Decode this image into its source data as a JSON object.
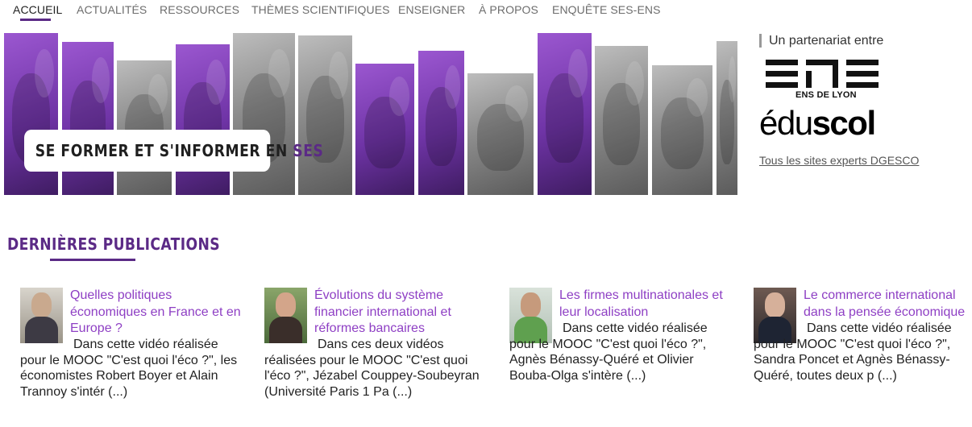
{
  "nav": {
    "items": [
      {
        "label": "ACCUEIL",
        "active": true
      },
      {
        "label": "ACTUALITÉS",
        "active": false
      },
      {
        "label": "RESSOURCES",
        "active": false
      },
      {
        "label": "THÈMES SCIENTIFIQUES",
        "active": false
      },
      {
        "label": "ENSEIGNER",
        "active": false
      },
      {
        "label": "À PROPOS",
        "active": false
      },
      {
        "label": "ENQUÊTE SES-ENS",
        "active": false
      }
    ]
  },
  "banner": {
    "label_main": "SE FORMER ET S'INFORMER EN ",
    "label_accent": "SES",
    "strips": [
      "purple",
      "purple",
      "gray",
      "purple",
      "gray",
      "gray",
      "purple",
      "purple",
      "gray",
      "purple",
      "gray",
      "gray",
      "gray"
    ]
  },
  "partner": {
    "title": "Un partenariat entre",
    "ens_logo_text": "ENS",
    "ens_subtitle": "ENS DE LYON",
    "eduscol_light": "édu",
    "eduscol_bold": "scol",
    "link": "Tous les sites experts DGESCO"
  },
  "section": {
    "title": "DERNIÈRES PUBLICATIONS"
  },
  "publications": [
    {
      "title": "Quelles politiques économiques en France et en Europe ?",
      "excerpt": "Dans cette vidéo réalisée pour le MOOC \"C'est quoi l'éco ?\", les économistes Robert Boyer et Alain Trannoy s'intér (...)",
      "thumb_icon": "portrait-photo"
    },
    {
      "title": "Évolutions du système financier international et réformes bancaires",
      "excerpt": "Dans ces deux vidéos réalisées pour le MOOC \"C'est quoi l'éco ?\", Jézabel Couppey-Soubeyran (Université Paris 1 Pa (...)",
      "thumb_icon": "portrait-photo"
    },
    {
      "title": "Les firmes multinationales et leur localisation",
      "excerpt": "Dans cette vidéo réalisée pour le MOOC \"C'est quoi l'éco ?\", Agnès Bénassy-Quéré et Olivier Bouba-Olga s'intère (...)",
      "thumb_icon": "portrait-photo"
    },
    {
      "title": "Le commerce international dans la pensée économique",
      "excerpt": "Dans cette vidéo réalisée pour le MOOC \"C'est quoi l'éco ?\", Sandra Poncet et Agnès Bénassy-Quéré, toutes deux p (...)",
      "thumb_icon": "portrait-photo"
    }
  ],
  "colors": {
    "brand_purple": "#5b2a86",
    "link_purple": "#8e3fc4",
    "nav_gray": "#6d6d6d"
  }
}
